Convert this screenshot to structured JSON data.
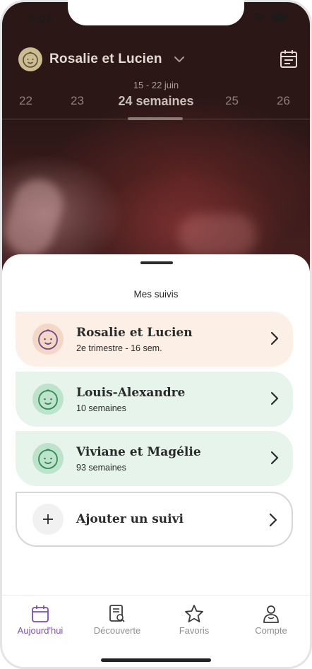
{
  "status": {
    "time": "5:02"
  },
  "header": {
    "title": "Rosalie et Lucien",
    "avatar_icon": "baby-face-icon",
    "calendar_icon": "calendar-icon"
  },
  "weeks": {
    "range": "15 - 22 juin",
    "items": [
      "22",
      "23",
      "24 semaines",
      "25",
      "26"
    ],
    "current": "24 semaines"
  },
  "sheet": {
    "title": "Mes suivis",
    "follows": [
      {
        "name": "Rosalie et Lucien",
        "subtitle": "2e trimestre - 16 sem.",
        "color": "#fcefe5",
        "icon": "baby-face-icon"
      },
      {
        "name": "Louis-Alexandre",
        "subtitle": "10 semaines",
        "color": "#e6f4ec",
        "icon": "baby-face-icon"
      },
      {
        "name": "Viviane et Magélie",
        "subtitle": "93 semaines",
        "color": "#e6f4ec",
        "icon": "baby-face-icon"
      }
    ],
    "add_label": "Ajouter un suivi"
  },
  "tabs": [
    {
      "label": "Aujourd'hui",
      "icon": "calendar-icon",
      "active": true
    },
    {
      "label": "Découverte",
      "icon": "book-search-icon",
      "active": false
    },
    {
      "label": "Favoris",
      "icon": "star-icon",
      "active": false
    },
    {
      "label": "Compte",
      "icon": "person-icon",
      "active": false
    }
  ],
  "colors": {
    "accent": "#7b4fb0",
    "peach": "#fcefe5",
    "mint": "#e6f4ec"
  }
}
